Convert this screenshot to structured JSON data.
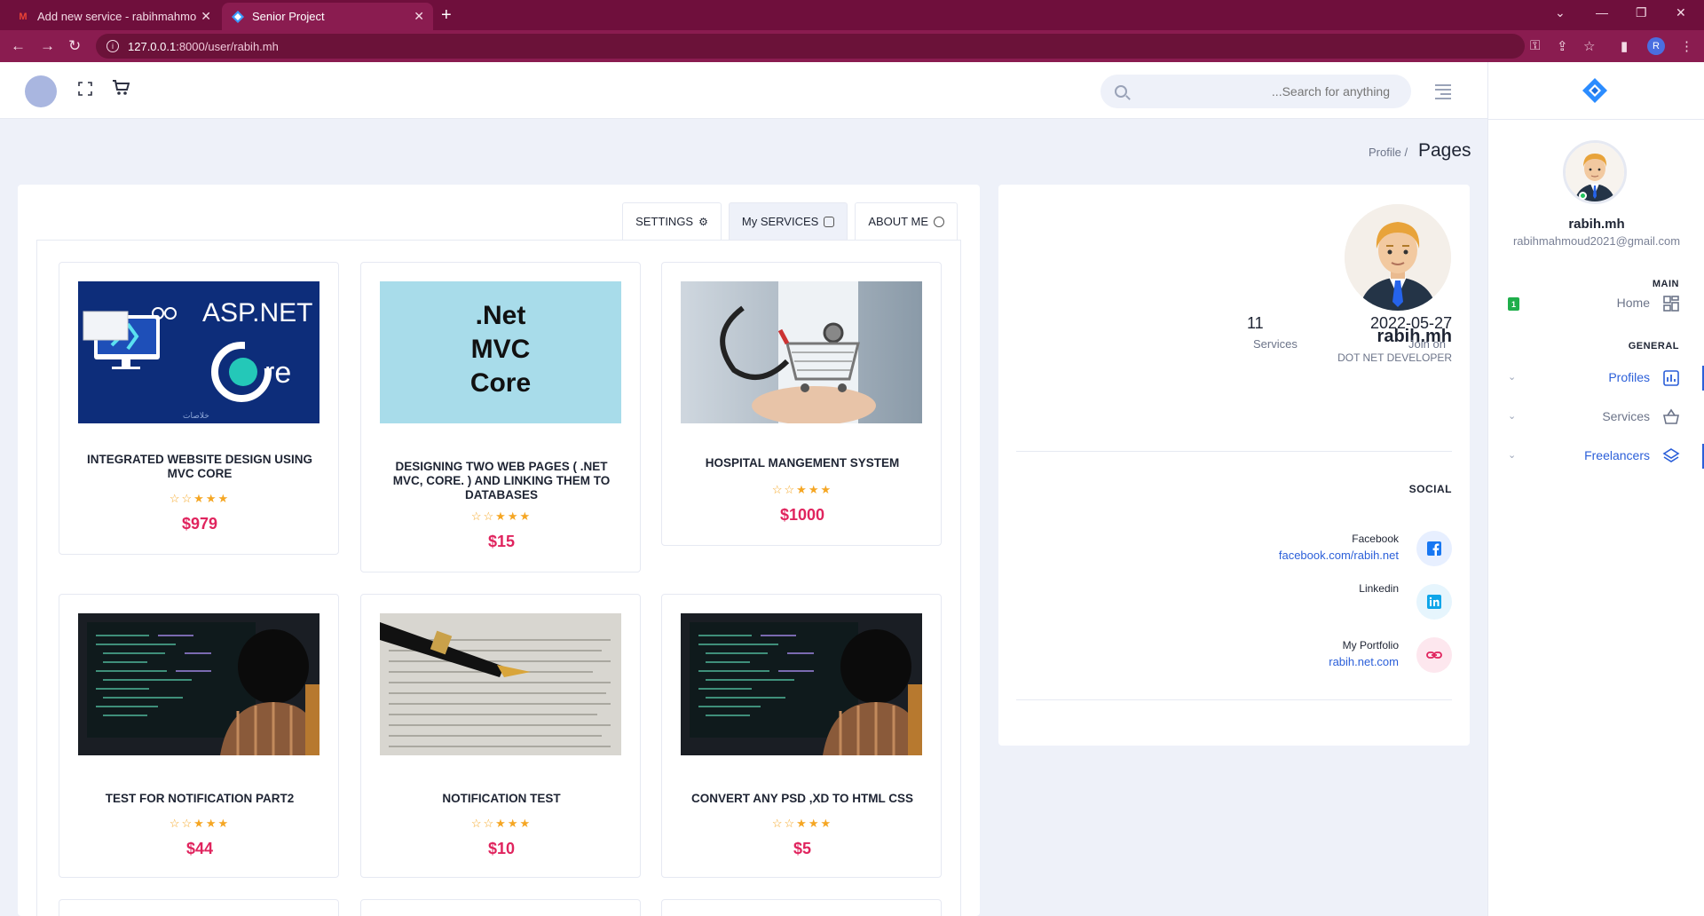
{
  "browser": {
    "tabs": [
      {
        "title": "Add new service - rabihmahmoud",
        "active": false
      },
      {
        "title": "Senior Project",
        "active": true
      }
    ],
    "url_host": "127.0.0.1",
    "url_path": ":8000/user/rabih.mh",
    "profile_initial": "R"
  },
  "header": {
    "search_placeholder": "...Search for anything"
  },
  "breadcrumb": {
    "link": "Profile /",
    "title": "Pages"
  },
  "tabs": {
    "settings": "SETTINGS",
    "my_services": "My SERVICES",
    "about_me": "ABOUT ME"
  },
  "services": [
    {
      "title": "INTEGRATED WEBSITE DESIGN USING MVC CORE",
      "stars": "☆☆★★★",
      "price": "$979",
      "image": "asp-net-core"
    },
    {
      "title": "DESIGNING TWO WEB PAGES ( .NET MVC, CORE. ) AND LINKING THEM TO DATABASES",
      "stars": "☆☆★★★",
      "price": "$15",
      "image": "net-mvc-core"
    },
    {
      "title": "HOSPITAL MANGEMENT SYSTEM",
      "stars": "☆☆★★★",
      "price": "$1000",
      "image": "shopping-cart-stethoscope"
    },
    {
      "title": "TEST FOR NOTIFICATION PART2",
      "stars": "☆☆★★★",
      "price": "$44",
      "image": "coder-at-monitor"
    },
    {
      "title": "NOTIFICATION TEST",
      "stars": "☆☆★★★",
      "price": "$10",
      "image": "fountain-pen-on-book"
    },
    {
      "title": "CONVERT ANY PSD ,XD TO HTML CSS",
      "stars": "☆☆★★★",
      "price": "$5",
      "image": "coder-at-monitor"
    }
  ],
  "service_images": {
    "asp_line1": "ASP.NET",
    "asp_line2": "re",
    "asp_caption": "خلاصات",
    "net_lines": [
      ".Net",
      "MVC",
      "Core"
    ]
  },
  "profile": {
    "name": "rabih.mh",
    "role": "DOT NET DEVELOPER",
    "services_count": "11",
    "services_label": "Services",
    "join_date": "2022-05-27",
    "join_label": "Join on",
    "social_title": "SOCIAL",
    "social": [
      {
        "name": "Facebook",
        "link": "facebook.com/rabih.net",
        "icon": "facebook-icon",
        "color": "#1877f2",
        "bg": "#e7efff"
      },
      {
        "name": "Linkedin",
        "link": "",
        "icon": "linkedin-icon",
        "color": "#0ea5e9",
        "bg": "#e6f5fd"
      },
      {
        "name": "My Portfolio",
        "link": "rabih.net.com",
        "icon": "link-icon",
        "color": "#e0245e",
        "bg": "#fde7ee"
      }
    ]
  },
  "sidebar": {
    "name": "rabih.mh",
    "email": "rabihmahmoud2021@gmail.com",
    "main_label": "MAIN",
    "general_label": "GENERAL",
    "home_badge": "1",
    "items": [
      {
        "label": "Home",
        "icon": "grid-icon",
        "active": false
      },
      {
        "label": "Profiles",
        "icon": "bar-chart-icon",
        "active": true
      },
      {
        "label": "Services",
        "icon": "basket-icon",
        "active": false
      },
      {
        "label": "Freelancers",
        "icon": "layers-icon",
        "active": true
      }
    ]
  },
  "colors": {
    "brand": "#2b5fd9",
    "price": "#e0245e",
    "star": "#f5a623",
    "browser_frame": "#8a1c50"
  }
}
